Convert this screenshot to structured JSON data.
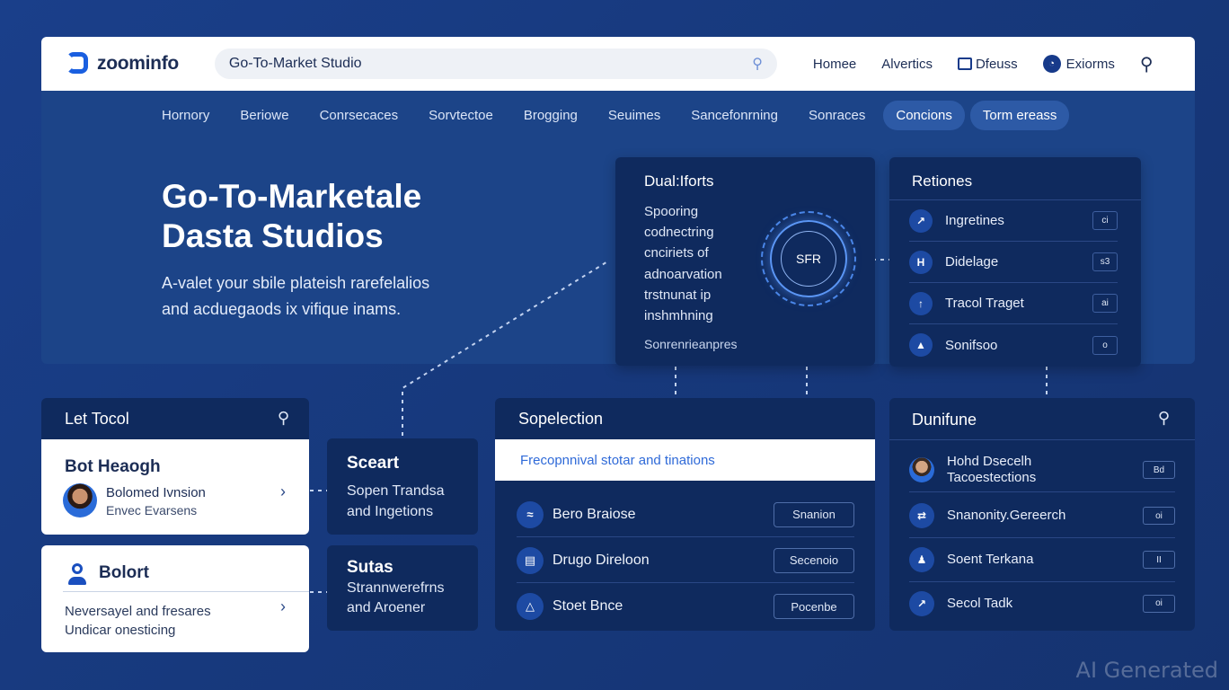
{
  "topbar": {
    "logo_text": "zoominfo",
    "search_value": "Go-To-Market Studio",
    "nav": [
      "Homee",
      "Alvertics",
      "Dfeuss",
      "Exiorms"
    ]
  },
  "subnav": {
    "tabs": [
      "Hornory",
      "Beriowe",
      "Conrsecaces",
      "Sorvtectoe",
      "Brogging",
      "Seuimes",
      "Sancefonrning",
      "Sonraces",
      "Concions",
      "Torm ereass"
    ]
  },
  "hero": {
    "title_line1": "Go-To-Marketale",
    "title_line2": "Dasta Studios",
    "sub_line1": "A-valet your sbile plateish rarefelalios",
    "sub_line2": "and acduegaods ix vifique inams."
  },
  "dual": {
    "title": "Dual:Iforts",
    "body": [
      "Spooring",
      "codnectring",
      "cnciriets of",
      "adnoarvation",
      "trstnunat ip",
      "inshmhning"
    ],
    "ring_label": "SFR",
    "footer": "Sonrenrieanpres"
  },
  "retiones": {
    "title": "Retiones",
    "items": [
      {
        "icon": "graph-icon",
        "label": "Ingretines",
        "badge": "ci"
      },
      {
        "icon": "h-icon",
        "label": "Didelage",
        "badge": "s3"
      },
      {
        "icon": "upload-icon",
        "label": "Tracol Traget",
        "badge": "ai"
      },
      {
        "icon": "chart-icon",
        "label": "Sonifsoo",
        "badge": "o"
      }
    ]
  },
  "left_tool": {
    "header": "Let Tocol",
    "bot_title": "Bot Heaogh",
    "bot_name": "Bolomed Ivnsion",
    "bot_sub": "Envec Evarsens",
    "bolort_title": "Bolort",
    "bolort_line1": "Neversayel and fresares",
    "bolort_line2": "Undicar onesticing"
  },
  "sceart": {
    "title": "Sceart",
    "desc_line1": "Sopen Trandsa",
    "desc_line2": "and Ingetions"
  },
  "sutas": {
    "title": "Sutas",
    "desc_line1": "Strannwerefrns",
    "desc_line2": "and Aroener"
  },
  "selection": {
    "title": "Sopelection",
    "input_placeholder": "Frecopnnival stotar and tinations",
    "rows": [
      {
        "icon": "wave-icon",
        "label": "Bero Braiose",
        "button": "Snanion"
      },
      {
        "icon": "book-icon",
        "label": "Drugo Direloon",
        "button": "Secenoio"
      },
      {
        "icon": "flask-icon",
        "label": "Stoet Bnce",
        "button": "Pocenbe"
      }
    ]
  },
  "dunifune": {
    "title": "Dunifune",
    "rows": [
      {
        "icon": "avatar",
        "label_line1": "Hohd Dsecelh",
        "label_line2": "Tacoestections",
        "badge": "Bd"
      },
      {
        "icon": "shuffle-icon",
        "label_line1": "Snanonity.Gereerch",
        "label_line2": "",
        "badge": "oi"
      },
      {
        "icon": "user-icon",
        "label_line1": "Soent Terkana",
        "label_line2": "",
        "badge": "II"
      },
      {
        "icon": "arrow-icon",
        "label_line1": "Secol Tadk",
        "label_line2": "",
        "badge": "oi"
      }
    ]
  },
  "watermark": "AI Generated",
  "colors": {
    "background": "#1a3f8a",
    "panel": "#1c4488",
    "card": "#0f2a5e",
    "accent": "#1a5fe0"
  }
}
